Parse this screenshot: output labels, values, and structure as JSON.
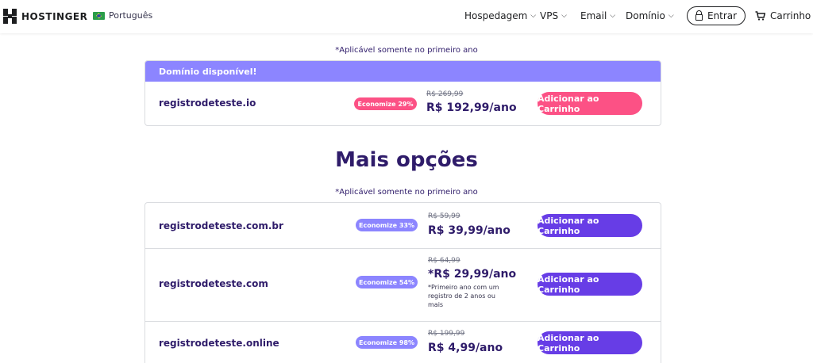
{
  "header": {
    "brand": "HOSTINGER",
    "language": "Português",
    "nav": [
      "Hospedagem",
      "VPS",
      "Email",
      "Domínio"
    ],
    "login_label": "Entrar",
    "cart_label": "Carrinho"
  },
  "note": "*Aplicável somente no primeiro ano",
  "featured": {
    "header": "Domínio disponível!",
    "domain": "registrodeteste.io",
    "badge": "Economize 29%",
    "old_price": "R$ 269,99",
    "price": "R$ 192,99/ano",
    "button": "Adicionar ao Carrinho"
  },
  "more_title": "Mais opções",
  "more_note": "*Aplicável somente no primeiro ano",
  "options": [
    {
      "domain": "registrodeteste.com.br",
      "badge": "Economize 33%",
      "old_price": "R$ 59,99",
      "price": "R$ 39,99/ano",
      "fine": "",
      "button": "Adicionar ao Carrinho"
    },
    {
      "domain": "registrodeteste.com",
      "badge": "Economize 54%",
      "old_price": "R$ 64,99",
      "price": "*R$ 29,99/ano",
      "fine": "*Primeiro ano com um registro de 2 anos ou mais",
      "button": "Adicionar ao Carrinho"
    },
    {
      "domain": "registrodeteste.online",
      "badge": "Economize 98%",
      "old_price": "R$ 199,99",
      "price": "R$ 4,99/ano",
      "fine": "",
      "button": "Adicionar ao Carrinho"
    }
  ],
  "colors": {
    "primary": "#673de6",
    "accent": "#fc5185",
    "banner": "#8c85ff",
    "text": "#2f1c6a"
  },
  "icons": [
    "hostinger-logo-icon",
    "brazil-flag-icon",
    "chevron-down-icon",
    "lock-icon",
    "cart-icon"
  ]
}
